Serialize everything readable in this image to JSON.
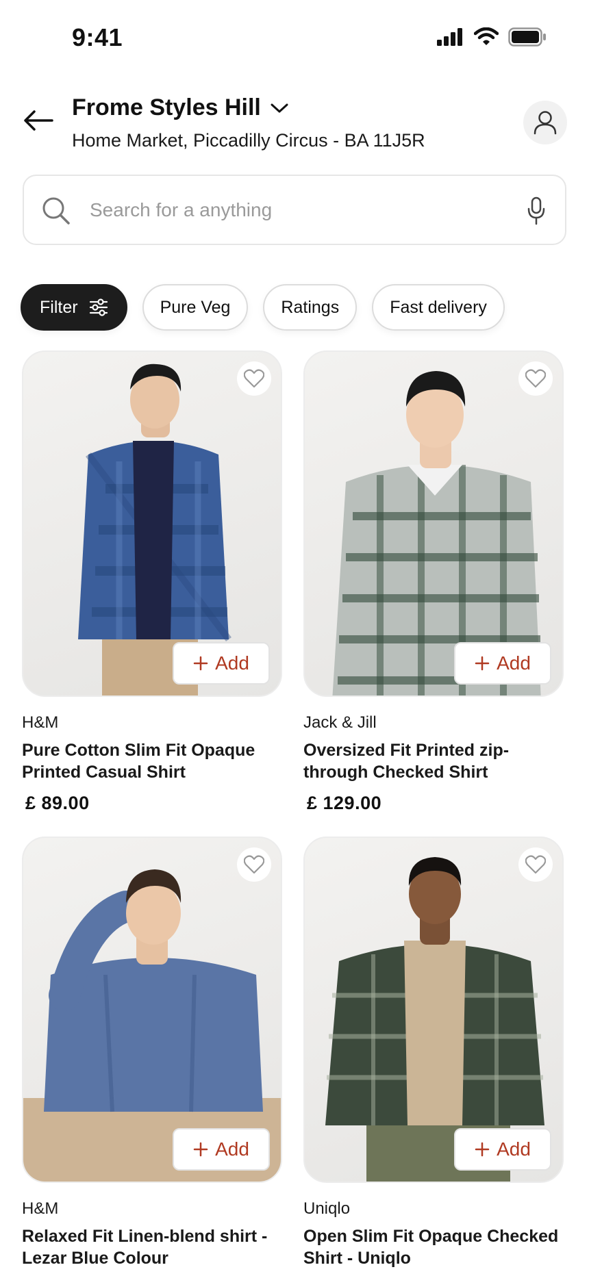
{
  "status_bar": {
    "time": "9:41"
  },
  "header": {
    "location_title": "Frome Styles Hill",
    "location_subtitle": "Home Market, Piccadilly Circus - BA 11J5R"
  },
  "search": {
    "placeholder": "Search for a anything"
  },
  "filters": {
    "filter_label": "Filter",
    "chips": [
      "Pure Veg",
      "Ratings",
      "Fast delivery"
    ]
  },
  "products": [
    {
      "brand": "H&M",
      "name": "Pure Cotton Slim Fit Opaque Printed Casual Shirt",
      "price": "£ 89.00",
      "add_label": "Add"
    },
    {
      "brand": "Jack & Jill",
      "name": "Oversized Fit Printed zip-through Checked Shirt",
      "price": "£ 129.00",
      "add_label": "Add"
    },
    {
      "brand": "H&M",
      "name": "Relaxed Fit Linen-blend shirt - Lezar Blue Colour",
      "price": "",
      "add_label": "Add"
    },
    {
      "brand": "Uniqlo",
      "name": "Open Slim Fit Opaque Checked Shirt - Uniqlo",
      "price": "",
      "add_label": "Add"
    }
  ],
  "colors": {
    "accent": "#b03a22",
    "filter_bg": "#1d1d1d"
  }
}
